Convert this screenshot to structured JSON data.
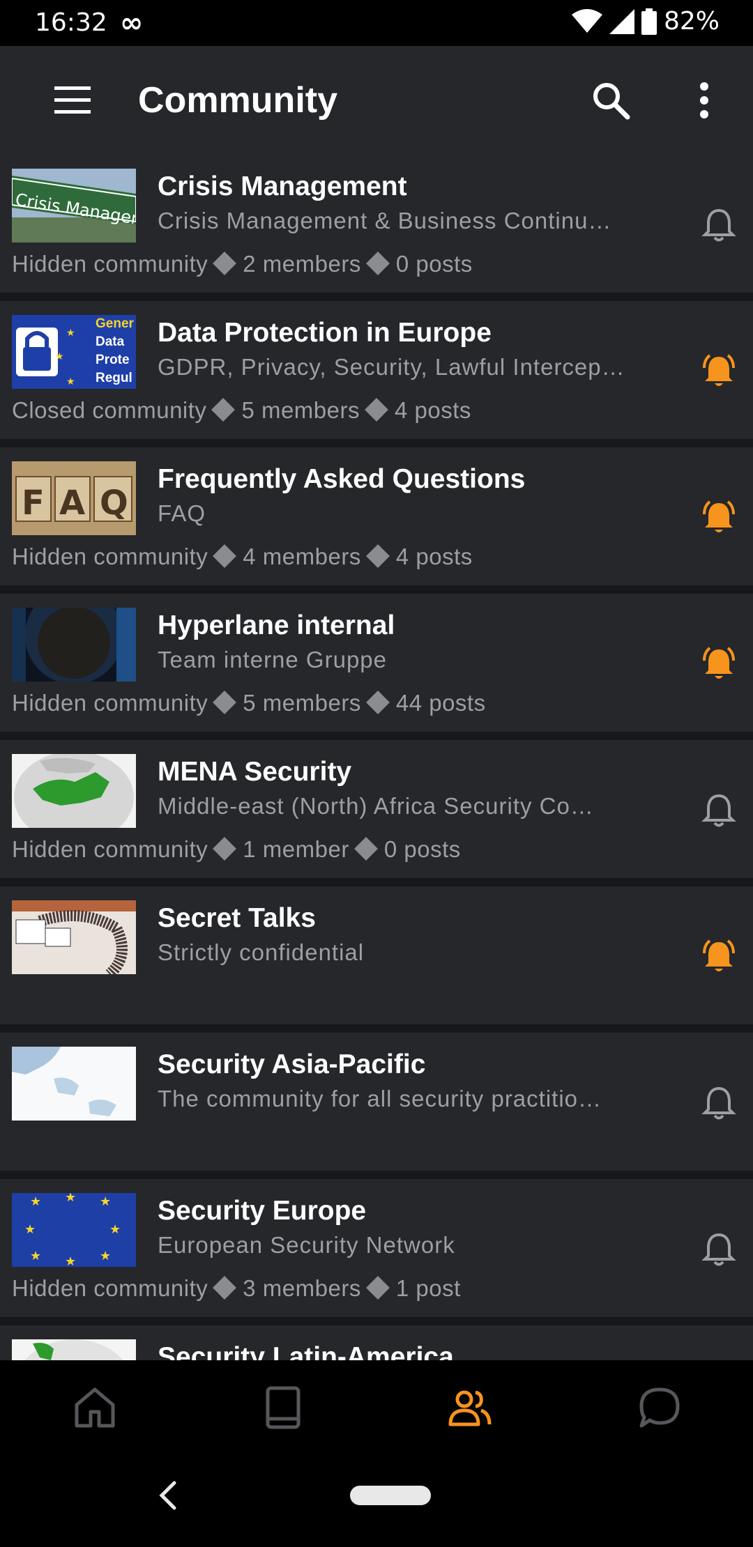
{
  "status_bar": {
    "time": "16:32",
    "battery": "82%"
  },
  "app_bar": {
    "title": "Community"
  },
  "colors": {
    "accent": "#f7941d",
    "muted": "#9d9fa3",
    "card": "#25272b"
  },
  "communities": [
    {
      "name": "Crisis Management",
      "description": "Crisis Management & Business Continu…",
      "type": "Hidden community",
      "members": "2 members",
      "posts": "0 posts",
      "notifications": false
    },
    {
      "name": "Data Protection in Europe",
      "description": "GDPR, Privacy, Security, Lawful Intercep…",
      "type": "Closed community",
      "members": "5 members",
      "posts": "4 posts",
      "notifications": true
    },
    {
      "name": "Frequently Asked Questions",
      "description": "FAQ",
      "type": "Hidden community",
      "members": "4 members",
      "posts": "4 posts",
      "notifications": true
    },
    {
      "name": "Hyperlane internal",
      "description": "Team interne Gruppe",
      "type": "Hidden community",
      "members": "5 members",
      "posts": "44 posts",
      "notifications": true
    },
    {
      "name": "MENA Security",
      "description": "Middle-east (North) Africa Security Co…",
      "type": "Hidden community",
      "members": "1 member",
      "posts": "0 posts",
      "notifications": false
    },
    {
      "name": "Secret Talks",
      "description": "Strictly confidential",
      "type": "",
      "members": "",
      "posts": "",
      "notifications": true
    },
    {
      "name": "Security Asia-Pacific",
      "description": "The community for all security practitio…",
      "type": "",
      "members": "",
      "posts": "",
      "notifications": false
    },
    {
      "name": "Security Europe",
      "description": "European Security Network",
      "type": "Hidden community",
      "members": "3 members",
      "posts": "1 post",
      "notifications": false
    },
    {
      "name": "Security Latin-America",
      "description": "",
      "type": "",
      "members": "",
      "posts": "",
      "notifications": false
    }
  ],
  "thumbnail_text": {
    "crisis": "Crisis Manageme",
    "gdpr": [
      "Gener",
      "Data",
      "Prote",
      "Regul"
    ],
    "faq": [
      "F",
      "A",
      "Q"
    ]
  },
  "bottom_nav": [
    {
      "icon": "home-icon",
      "active": false
    },
    {
      "icon": "book-icon",
      "active": false
    },
    {
      "icon": "people-icon",
      "active": true
    },
    {
      "icon": "chat-bubble-icon",
      "active": false
    }
  ]
}
